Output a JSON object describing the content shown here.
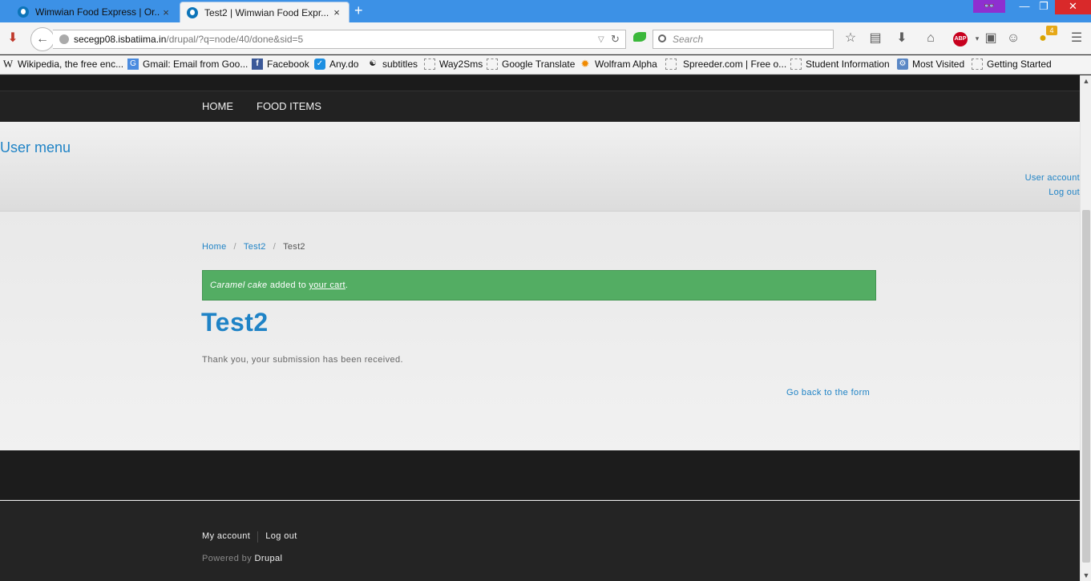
{
  "browser": {
    "tabs": [
      {
        "title": "Wimwian Food Express | Or...",
        "close": "×"
      },
      {
        "title": "Test2 | Wimwian Food Expr...",
        "close": "×"
      }
    ],
    "new_tab": "+",
    "mask_badge": "👓",
    "minimize": "—",
    "restore": "❐",
    "close": "✕",
    "url_host": "secegp08.isbatiima.in",
    "url_rest": "/drupal/?q=node/40/done&sid=5",
    "search_placeholder": "Search",
    "abp_label": "ABP",
    "ext_badge": "4",
    "bookmarks": [
      {
        "label": "Wikipedia, the free enc...",
        "icon": "W"
      },
      {
        "label": "Gmail: Email from Goo...",
        "icon": "G"
      },
      {
        "label": "Facebook",
        "icon": "f"
      },
      {
        "label": "Any.do",
        "icon": "✓"
      },
      {
        "label": "subtitles",
        "icon": "☯"
      },
      {
        "label": "Way2Sms",
        "icon": ""
      },
      {
        "label": "Google Translate",
        "icon": ""
      },
      {
        "label": "Wolfram Alpha",
        "icon": "✹"
      },
      {
        "label": "Spreeder.com | Free o...",
        "icon": ""
      },
      {
        "label": "Student Information",
        "icon": ""
      },
      {
        "label": "Most Visited",
        "icon": "⚙"
      },
      {
        "label": "Getting Started",
        "icon": ""
      }
    ]
  },
  "site": {
    "nav": [
      {
        "label": "HOME"
      },
      {
        "label": "FOOD ITEMS"
      }
    ],
    "user_menu": {
      "title": "User menu",
      "links": [
        "User account",
        "Log out"
      ]
    },
    "breadcrumb": {
      "home": "Home",
      "sep": "/",
      "parent": "Test2",
      "current": "Test2"
    },
    "status": {
      "item": "Caramel cake",
      "middle": " added to ",
      "link": "your cart",
      "end": "."
    },
    "page_title": "Test2",
    "confirmation": "Thank you, your submission has been received.",
    "back_link": "Go back to the form",
    "footer": {
      "links": [
        "My account",
        "Log out"
      ],
      "powered_prefix": "Powered by ",
      "powered_link": "Drupal"
    }
  },
  "colors": {
    "accent": "#1f83c6",
    "status_green": "#53ad63",
    "dark_bar": "#222222",
    "tabbar_blue": "#3c91e6"
  }
}
